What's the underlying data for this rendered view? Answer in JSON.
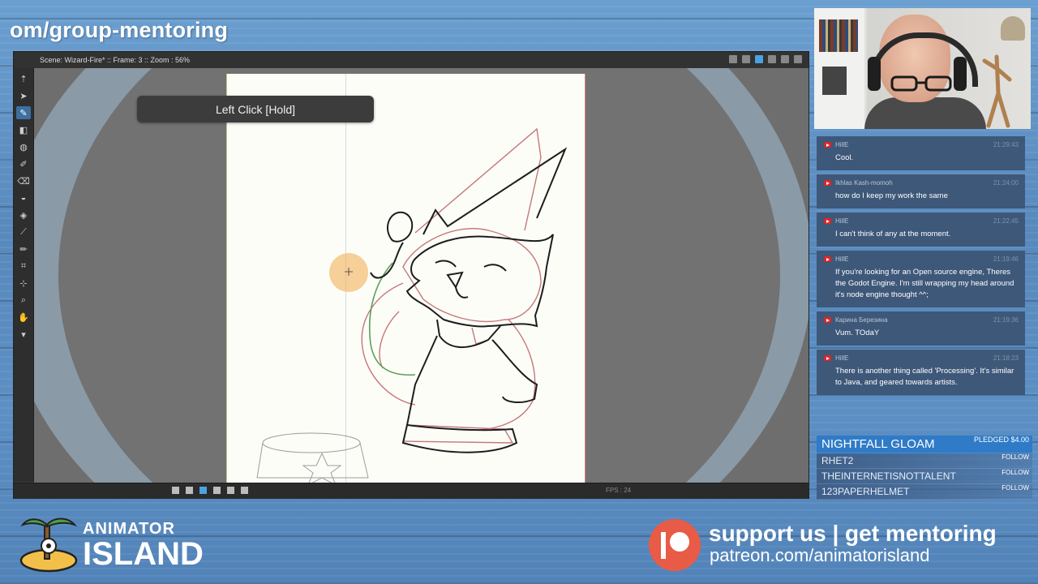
{
  "banner": {
    "url_text": "om/group-mentoring"
  },
  "editor": {
    "scene_info": "Scene: Wizard-Fire*  ::  Frame: 3  ::  Zoom : 56%",
    "tooltip": "Left Click [Hold]",
    "fps_text": "FPS : 24",
    "tools": [
      "arrow-up-icon",
      "select-icon",
      "brush-icon",
      "shape-icon",
      "fill-icon",
      "paint-icon",
      "eraser-icon",
      "smudge-icon",
      "bucket-icon",
      "eyedropper-icon",
      "pencil-icon",
      "ruler-icon",
      "transform-icon",
      "zoom-icon",
      "hand-icon",
      "more-icon"
    ],
    "active_tool": "brush-icon"
  },
  "chat": {
    "messages": [
      {
        "user": "HillE",
        "time": "21:29:43",
        "text": "Cool."
      },
      {
        "user": "Ikhlas Kash-momoh",
        "time": "21:24:00",
        "text": "how do I keep my work the same"
      },
      {
        "user": "HillE",
        "time": "21:22:45",
        "text": "I can't think of any at the moment."
      },
      {
        "user": "HillE",
        "time": "21:19:46",
        "text": "If you're looking for an Open source engine, Theres the Godot Engine. I'm still wrapping my head around it's node engine thought ^^;"
      },
      {
        "user": "Карина Березина",
        "time": "21:19:36",
        "text": "Vum. TOdaY"
      },
      {
        "user": "HillE",
        "time": "21:18:23",
        "text": "There is another thing called 'Processing'. It's similar to Java, and geared towards artists."
      }
    ]
  },
  "supporters": {
    "top": {
      "name": "NIGHTFALL GLOAM",
      "badge": "PLEDGED $4.00"
    },
    "followers": [
      {
        "name": "RHET2",
        "badge": "FOLLOW"
      },
      {
        "name": "THEINTERNETISNOTTALENT",
        "badge": "FOLLOW"
      },
      {
        "name": "123PAPERHELMET",
        "badge": "FOLLOW"
      }
    ]
  },
  "branding": {
    "logo_line1": "ANIMATOR",
    "logo_line2": "ISLAND",
    "support_text": "support us | get mentoring",
    "support_url": "patreon.com/animatorisland"
  },
  "colors": {
    "accent_blue": "#2f7bc7",
    "patreon": "#e85b46",
    "chat_bg": "#3e5879"
  }
}
